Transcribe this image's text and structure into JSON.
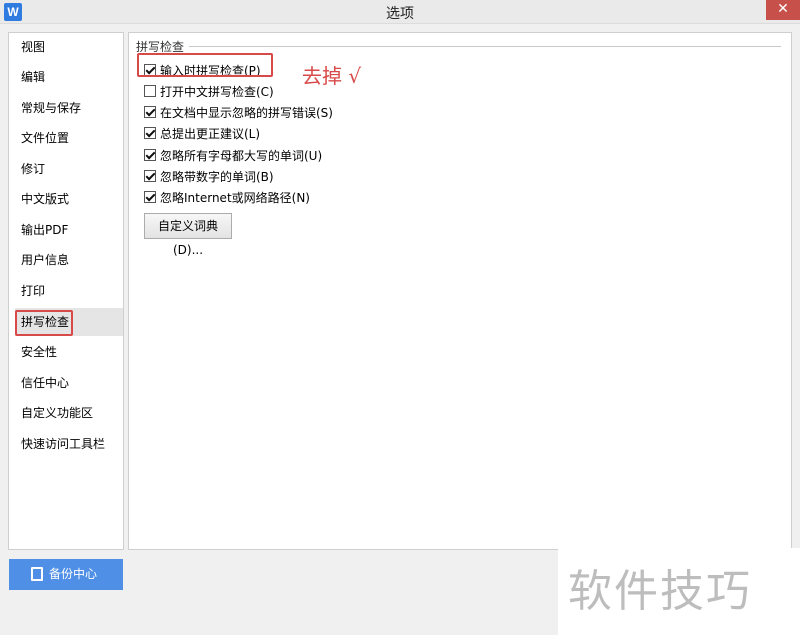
{
  "window": {
    "title": "选项",
    "app_icon_letter": "W",
    "close_glyph": "✕"
  },
  "sidebar": {
    "items": [
      {
        "label": "视图"
      },
      {
        "label": "编辑"
      },
      {
        "label": "常规与保存"
      },
      {
        "label": "文件位置"
      },
      {
        "label": "修订"
      },
      {
        "label": "中文版式"
      },
      {
        "label": "输出PDF"
      },
      {
        "label": "用户信息"
      },
      {
        "label": "打印"
      },
      {
        "label": "拼写检查"
      },
      {
        "label": "安全性"
      },
      {
        "label": "信任中心"
      },
      {
        "label": "自定义功能区"
      },
      {
        "label": "快速访问工具栏"
      }
    ],
    "selected": "拼写检查"
  },
  "spellcheck": {
    "section_title": "拼写检查",
    "options": [
      {
        "label": "输入时拼写检查(P)",
        "checked": true
      },
      {
        "label": "打开中文拼写检查(C)",
        "checked": false
      },
      {
        "label": "在文档中显示忽略的拼写错误(S)",
        "checked": true
      },
      {
        "label": "总提出更正建议(L)",
        "checked": true
      },
      {
        "label": "忽略所有字母都大写的单词(U)",
        "checked": true
      },
      {
        "label": "忽略带数字的单词(B)",
        "checked": true
      },
      {
        "label": "忽略Internet或网络路径(N)",
        "checked": true
      }
    ],
    "custom_dict_button": "自定义词典(D)..."
  },
  "annotation": "去掉 √",
  "backup_button": "备份中心",
  "watermark": "软件技巧",
  "colors": {
    "annotation_red": "#d84a4a",
    "accent_blue": "#4f8fe6"
  }
}
